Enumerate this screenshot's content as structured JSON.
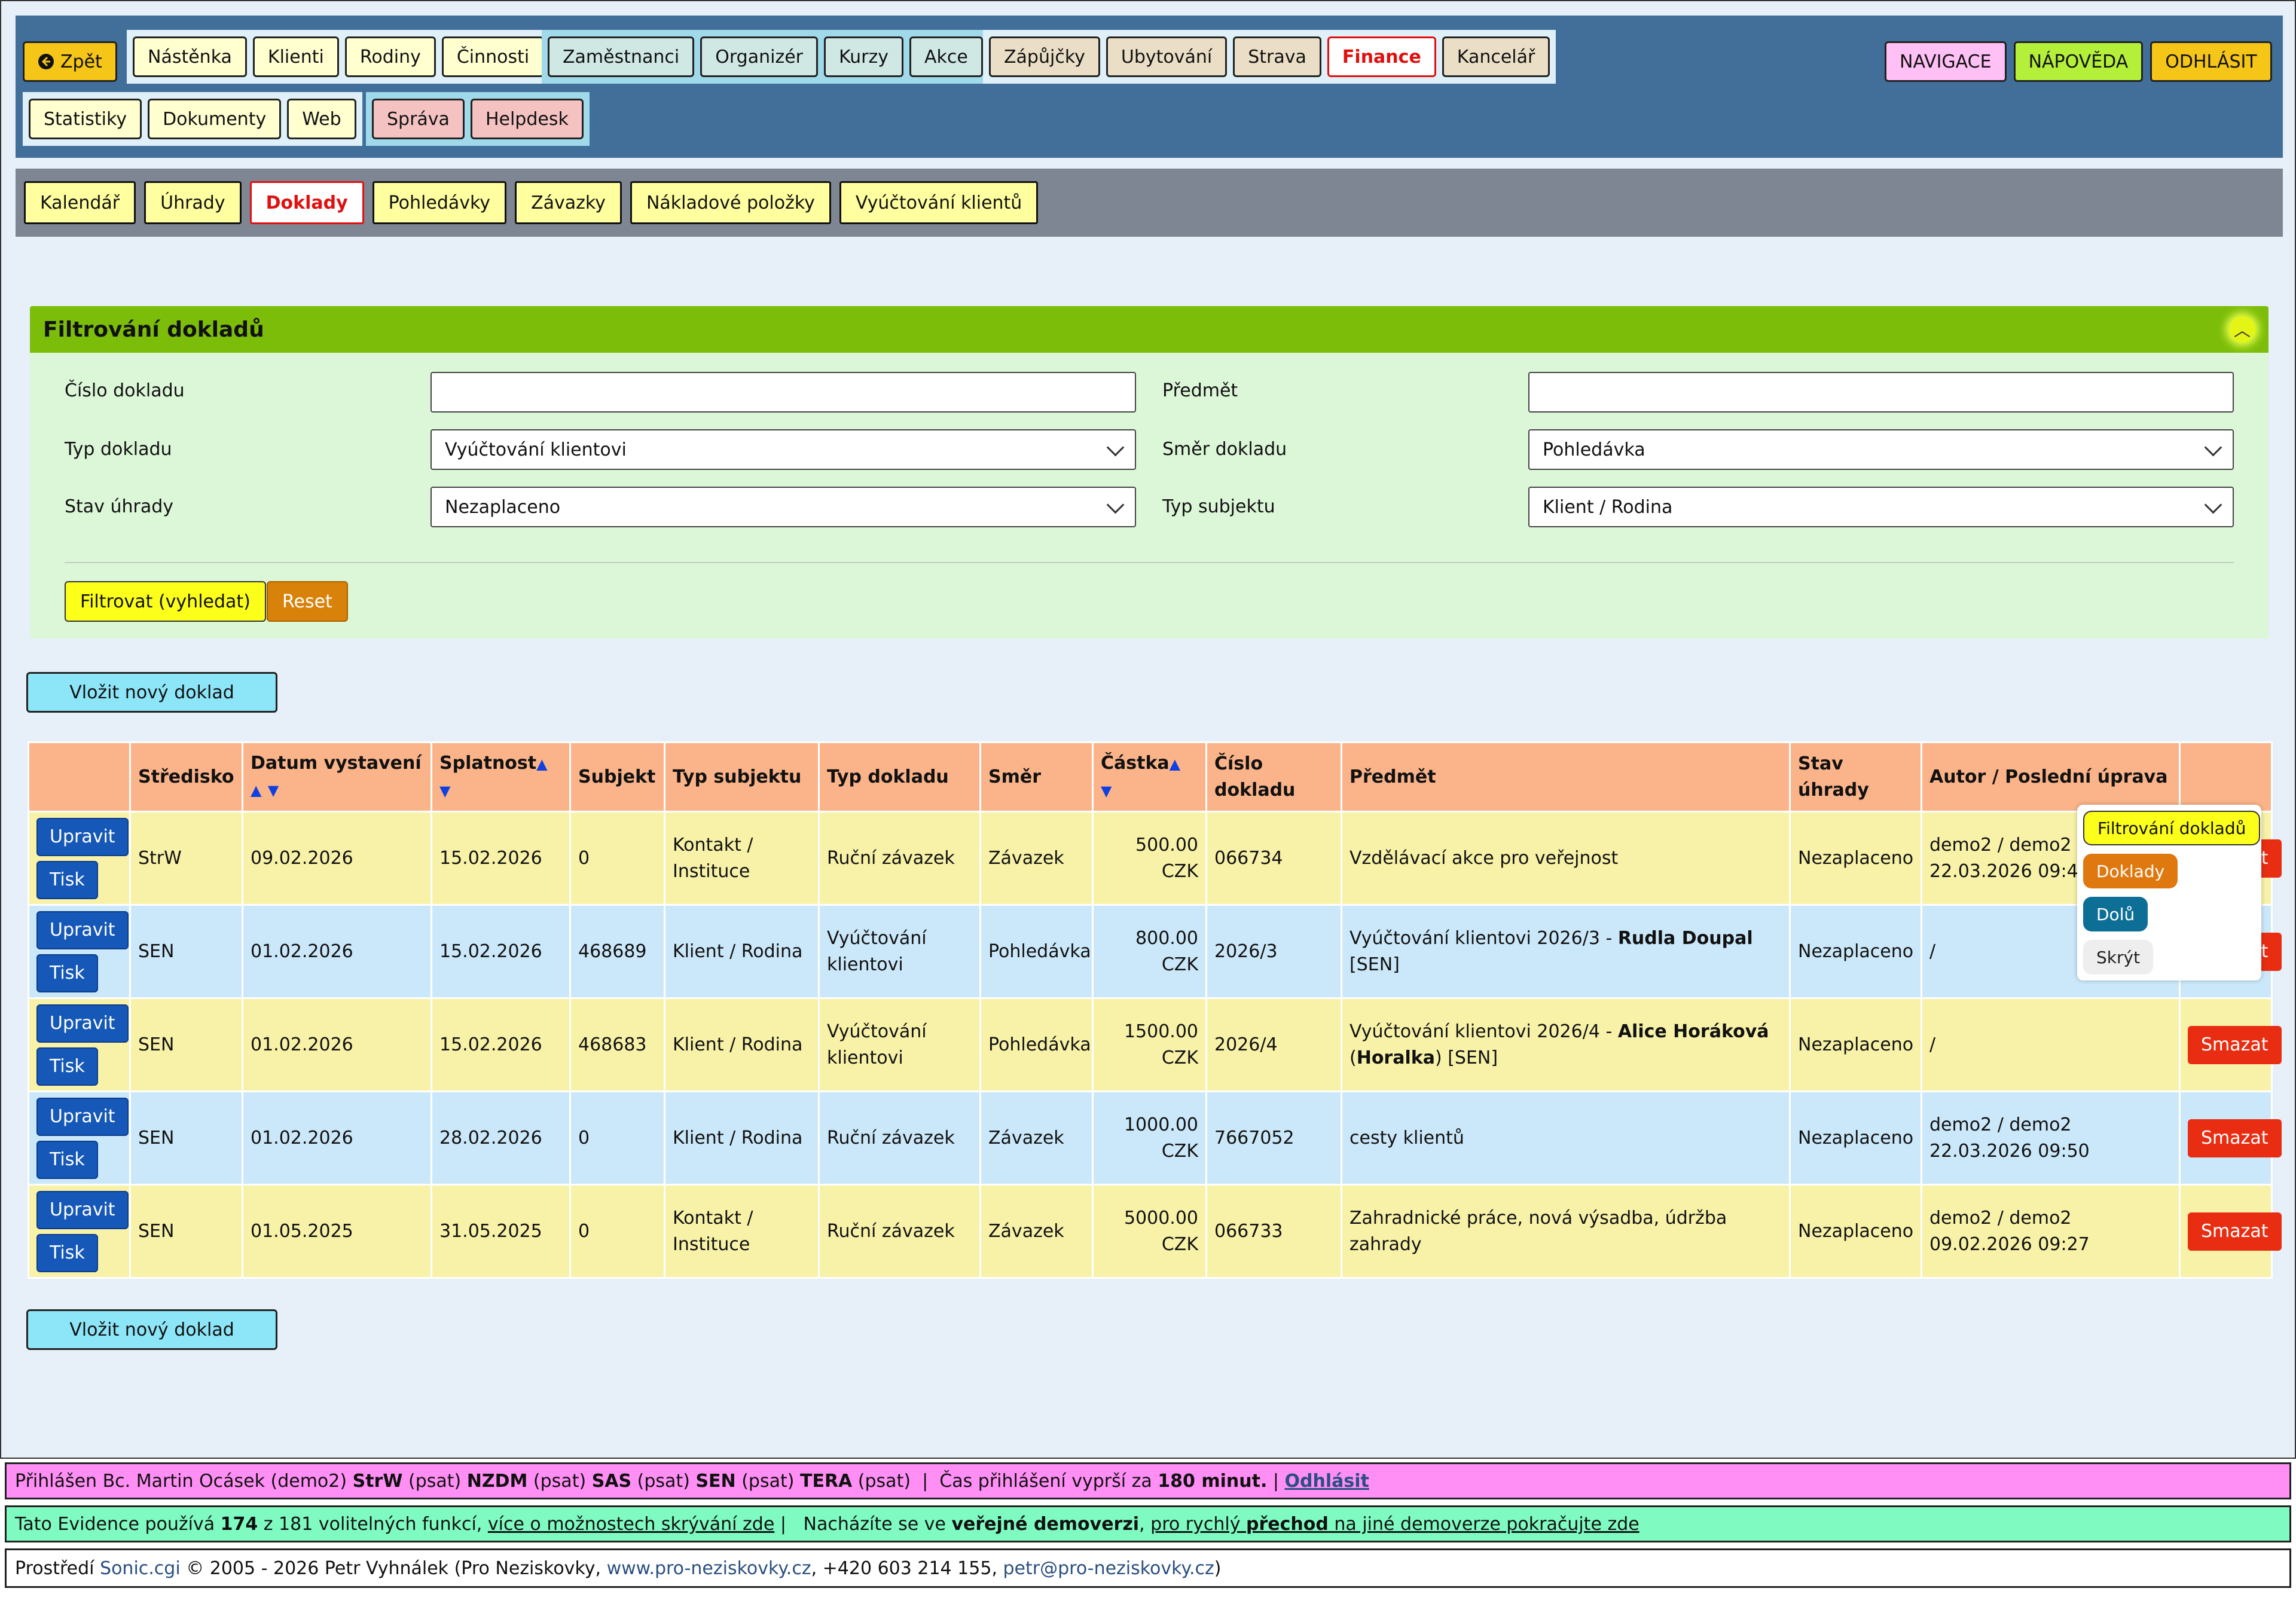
{
  "topnav": {
    "back": "Zpět",
    "group1": [
      "Nástěnka",
      "Klienti",
      "Rodiny",
      "Činnosti"
    ],
    "group2": [
      "Zaměstnanci",
      "Organizér",
      "Kurzy",
      "Akce"
    ],
    "group3": [
      "Zápůjčky",
      "Ubytování",
      "Strava",
      "Finance",
      "Kancelář"
    ],
    "group4": [
      "Statistiky",
      "Dokumenty",
      "Web"
    ],
    "group5": [
      "Správa",
      "Helpdesk"
    ],
    "right": [
      "NAVIGACE",
      "NÁPOVĚDA",
      "ODHLÁSIT"
    ]
  },
  "subnav": [
    "Kalendář",
    "Úhrady",
    "Doklady",
    "Pohledávky",
    "Závazky",
    "Nákladové položky",
    "Vyúčtování klientů"
  ],
  "filter": {
    "title": "Filtrování dokladů",
    "labels": {
      "cislo": "Číslo dokladu",
      "predmet": "Předmět",
      "typ": "Typ dokladu",
      "smer": "Směr dokladu",
      "stav": "Stav úhrady",
      "subjekt": "Typ subjektu"
    },
    "values": {
      "cislo": "",
      "predmet": "",
      "typ": "Vyúčtování klientovi",
      "smer": "Pohledávka",
      "stav": "Nezaplaceno",
      "subjekt": "Klient / Rodina"
    },
    "submit": "Filtrovat (vyhledat)",
    "reset": "Reset"
  },
  "new_button": "Vložit nový doklad",
  "table": {
    "headers": [
      "",
      "Středisko",
      "Datum vystavení",
      "Splatnost",
      "Subjekt",
      "Typ subjektu",
      "Typ dokladu",
      "Směr",
      "Částka",
      "Číslo dokladu",
      "Předmět",
      "Stav úhrady",
      "Autor / Poslední úprava",
      ""
    ],
    "sort": {
      "up": "▲",
      "down": "▼"
    },
    "actions": {
      "edit": "Upravit",
      "print": "Tisk",
      "delete": "Smazat"
    },
    "rows": [
      {
        "stredisko": "StrW",
        "datum": "09.02.2026",
        "splatnost": "15.02.2026",
        "subjekt": "0",
        "typ_subjektu": "Kontakt / Instituce",
        "typ_dokladu": "Ruční závazek",
        "smer": "Závazek",
        "castka": "500.00 CZK",
        "cislo": "066734",
        "predmet": "Vzdělávací akce pro veřejnost",
        "predmet_bold": "",
        "predmet_mid": "",
        "predmet_bold2": "",
        "predmet_tail": "",
        "stav": "Nezaplaceno",
        "autor": "demo2 / demo2 22.03.2026 09:49"
      },
      {
        "stredisko": "SEN",
        "datum": "01.02.2026",
        "splatnost": "15.02.2026",
        "subjekt": "468689",
        "typ_subjektu": "Klient / Rodina",
        "typ_dokladu": "Vyúčtování klientovi",
        "smer": "Pohledávka",
        "castka": "800.00 CZK",
        "cislo": "2026/3",
        "predmet": "Vyúčtování klientovi 2026/3 - ",
        "predmet_bold": "Rudla Doupal",
        "predmet_mid": " [SEN]",
        "predmet_bold2": "",
        "predmet_tail": "",
        "stav": "Nezaplaceno",
        "autor": "/"
      },
      {
        "stredisko": "SEN",
        "datum": "01.02.2026",
        "splatnost": "15.02.2026",
        "subjekt": "468683",
        "typ_subjektu": "Klient / Rodina",
        "typ_dokladu": "Vyúčtování klientovi",
        "smer": "Pohledávka",
        "castka": "1500.00 CZK",
        "cislo": "2026/4",
        "predmet": "Vyúčtování klientovi 2026/4 - ",
        "predmet_bold": "Alice Horáková",
        "predmet_mid": " (",
        "predmet_bold2": "Horalka",
        "predmet_tail": ") [SEN]",
        "stav": "Nezaplaceno",
        "autor": "/"
      },
      {
        "stredisko": "SEN",
        "datum": "01.02.2026",
        "splatnost": "28.02.2026",
        "subjekt": "0",
        "typ_subjektu": "Klient / Rodina",
        "typ_dokladu": "Ruční závazek",
        "smer": "Závazek",
        "castka": "1000.00 CZK",
        "cislo": "7667052",
        "predmet": "cesty klientů",
        "predmet_bold": "",
        "predmet_mid": "",
        "predmet_bold2": "",
        "predmet_tail": "",
        "stav": "Nezaplaceno",
        "autor": "demo2 / demo2 22.03.2026 09:50"
      },
      {
        "stredisko": "SEN",
        "datum": "01.05.2025",
        "splatnost": "31.05.2025",
        "subjekt": "0",
        "typ_subjektu": "Kontakt / Instituce",
        "typ_dokladu": "Ruční závazek",
        "smer": "Závazek",
        "castka": "5000.00 CZK",
        "cislo": "066733",
        "predmet": "Zahradnické práce, nová výsadba, údržba zahrady",
        "predmet_bold": "",
        "predmet_mid": "",
        "predmet_bold2": "",
        "predmet_tail": "",
        "stav": "Nezaplaceno",
        "autor": "demo2 / demo2 09.02.2026 09:27"
      }
    ]
  },
  "floating_menu": [
    "Filtrování dokladů",
    "Doklady",
    "Dolů",
    "Skrýt"
  ],
  "footer": {
    "login_prefix": "Přihlášen Bc. Martin Ocásek (demo2) ",
    "units": [
      {
        "name": "StrW",
        "role": " (psat) "
      },
      {
        "name": "NZDM",
        "role": " (psat) "
      },
      {
        "name": "SAS",
        "role": " (psat) "
      },
      {
        "name": "SEN",
        "role": " (psat) "
      },
      {
        "name": "TERA",
        "role": " (psat) "
      }
    ],
    "sep": " | ",
    "session_prefix": " Čas přihlášení vyprší za ",
    "session_value": "180 minut.",
    "logout": "Odhlásit",
    "features_prefix": "Tato Evidence používá ",
    "features_count": "174",
    "features_mid": " z 181 volitelných funkcí, ",
    "features_link": "více o možnostech skrývání zde",
    "demo_prefix": "  Nacházíte se ve ",
    "demo_bold": "veřejné demoverzi",
    "demo_comma": ", ",
    "demo_link_pre": "pro rychlý ",
    "demo_link_bold": "přechod",
    "demo_link_post": " na jiné demoverze pokračujte zde",
    "credits_prefix": "Prostředí ",
    "credits_sonic": "Sonic.cgi",
    "credits_mid": " © 2005 - 2026 Petr Vyhnálek (Pro Neziskovky, ",
    "credits_web": "www.pro-neziskovky.cz",
    "credits_phone": ", +420 603 214 155, ",
    "credits_mail": "petr@pro-neziskovky.cz",
    "credits_end": ")"
  },
  "colors": {
    "nav_bg": "#426f9a",
    "filter_head": "#7cbd0a",
    "row_yellow": "#f8f2a8",
    "row_blue": "#cbe8fa",
    "accent_red": "#e92d12",
    "accent_blue": "#1658b8"
  }
}
